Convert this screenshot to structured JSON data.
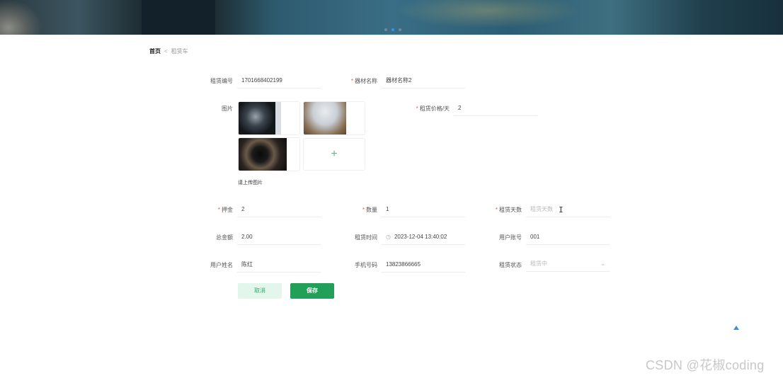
{
  "banner": {
    "carousel": {
      "count": 3,
      "active_index": 1
    }
  },
  "breadcrumb": {
    "home": "首页",
    "separator": "<",
    "current": "租赁车"
  },
  "form": {
    "rental_no": {
      "label": "租赁编号",
      "value": "1701668402199"
    },
    "equipment_name": {
      "label": "器材名称",
      "value": "器材名称2",
      "required": true
    },
    "images": {
      "label": "图片",
      "hint": "请上传图片",
      "upload_icon": "plus-icon"
    },
    "price_per_day": {
      "label": "租赁价格/天",
      "value": "2",
      "required": true
    },
    "deposit": {
      "label": "押金",
      "value": "2",
      "required": true
    },
    "quantity": {
      "label": "数量",
      "value": "1",
      "required": true
    },
    "rental_days": {
      "label": "租赁天数",
      "placeholder": "租赁天数",
      "required": true
    },
    "total_amount": {
      "label": "总金额",
      "value": "2.00"
    },
    "rental_time": {
      "label": "租赁时间",
      "value": "2023-12-04 13:40:02",
      "icon": "clock-icon"
    },
    "user_account": {
      "label": "用户账号",
      "value": "001"
    },
    "user_name": {
      "label": "用户姓名",
      "value": "陈红"
    },
    "phone": {
      "label": "手机号码",
      "value": "13823866665"
    },
    "rental_status": {
      "label": "租赁状态",
      "placeholder": "租赁中",
      "icon": "chevron-down-icon"
    }
  },
  "buttons": {
    "cancel": "取消",
    "save": "保存"
  },
  "colors": {
    "primary": "#22a05a",
    "cancel_bg": "#e3f6ec",
    "required": "#e85a4f",
    "accent_blue": "#2f95e8"
  },
  "watermark": "CSDN @花椒coding"
}
